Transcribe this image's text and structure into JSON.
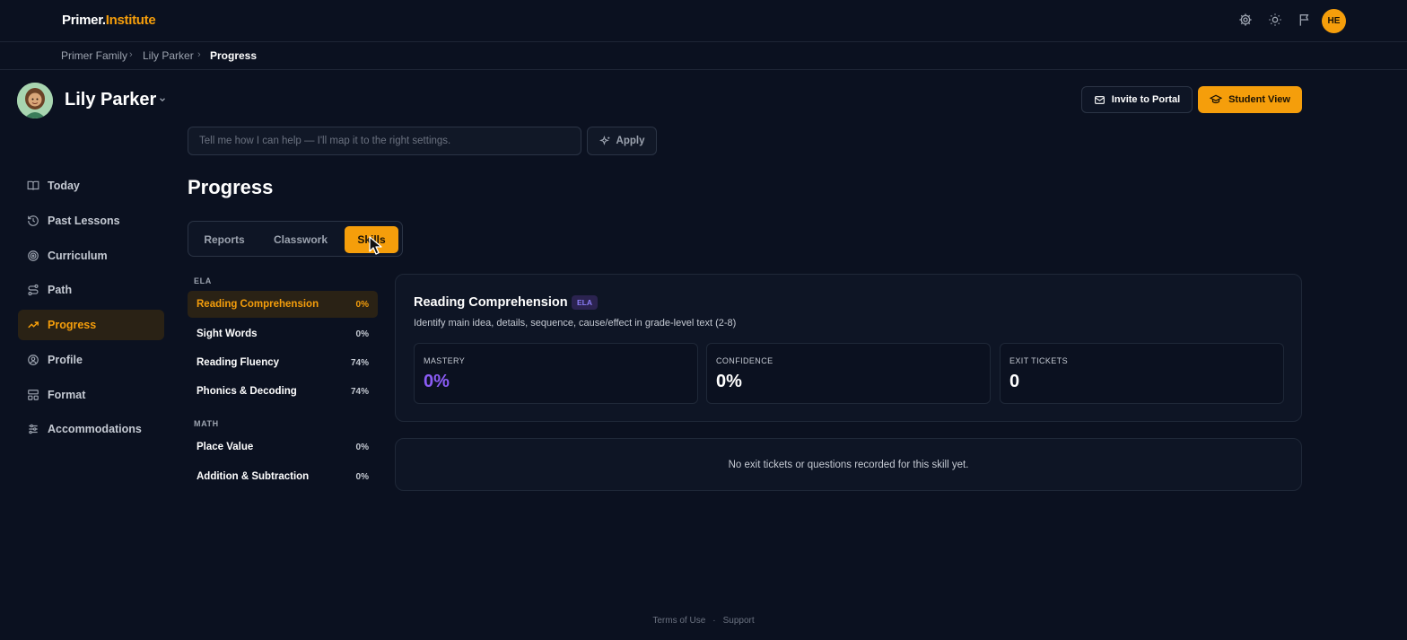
{
  "app": {
    "logo_part1": "Primer.",
    "logo_part2": "Institute"
  },
  "header_icons": [
    "gear-icon",
    "sun-icon",
    "flag-icon"
  ],
  "user": {
    "initials": "HE"
  },
  "breadcrumb": [
    "Primer Family",
    "Lily Parker",
    "Progress"
  ],
  "student": {
    "name": "Lily Parker"
  },
  "actions": {
    "invite": "Invite to Portal",
    "student_view": "Student View"
  },
  "helper": {
    "placeholder": "Tell me how I can help — I'll map it to the right settings.",
    "apply": "Apply"
  },
  "sidebar": {
    "items": [
      {
        "label": "Today",
        "icon": "book-icon"
      },
      {
        "label": "Past Lessons",
        "icon": "history-icon"
      },
      {
        "label": "Curriculum",
        "icon": "target-icon"
      },
      {
        "label": "Path",
        "icon": "route-icon"
      },
      {
        "label": "Progress",
        "icon": "trending-up-icon",
        "active": true
      },
      {
        "label": "Profile",
        "icon": "user-icon"
      },
      {
        "label": "Format",
        "icon": "layout-icon"
      },
      {
        "label": "Accommodations",
        "icon": "sliders-icon"
      }
    ]
  },
  "page": {
    "title": "Progress"
  },
  "tabs": [
    "Reports",
    "Classwork",
    "Skills"
  ],
  "active_tab": "Skills",
  "skill_groups": [
    {
      "name": "ELA",
      "skills": [
        {
          "name": "Reading Comprehension",
          "pct": "0%",
          "active": true
        },
        {
          "name": "Sight Words",
          "pct": "0%"
        },
        {
          "name": "Reading Fluency",
          "pct": "74%"
        },
        {
          "name": "Phonics & Decoding",
          "pct": "74%"
        }
      ]
    },
    {
      "name": "MATH",
      "skills": [
        {
          "name": "Place Value",
          "pct": "0%"
        },
        {
          "name": "Addition & Subtraction",
          "pct": "0%"
        }
      ]
    }
  ],
  "detail": {
    "title": "Reading Comprehension",
    "badge": "ELA",
    "description": "Identify main idea, details, sequence, cause/effect in grade-level text (2-8)",
    "stats": [
      {
        "label": "MASTERY",
        "value": "0%"
      },
      {
        "label": "CONFIDENCE",
        "value": "0%"
      },
      {
        "label": "EXIT TICKETS",
        "value": "0"
      }
    ],
    "empty_message": "No exit tickets or questions recorded for this skill yet."
  },
  "footer": {
    "terms": "Terms of Use",
    "separator": "·",
    "support": "Support"
  },
  "colors": {
    "accent": "#f59e0b",
    "background": "#0b1120",
    "purple": "#8b5cf6"
  }
}
